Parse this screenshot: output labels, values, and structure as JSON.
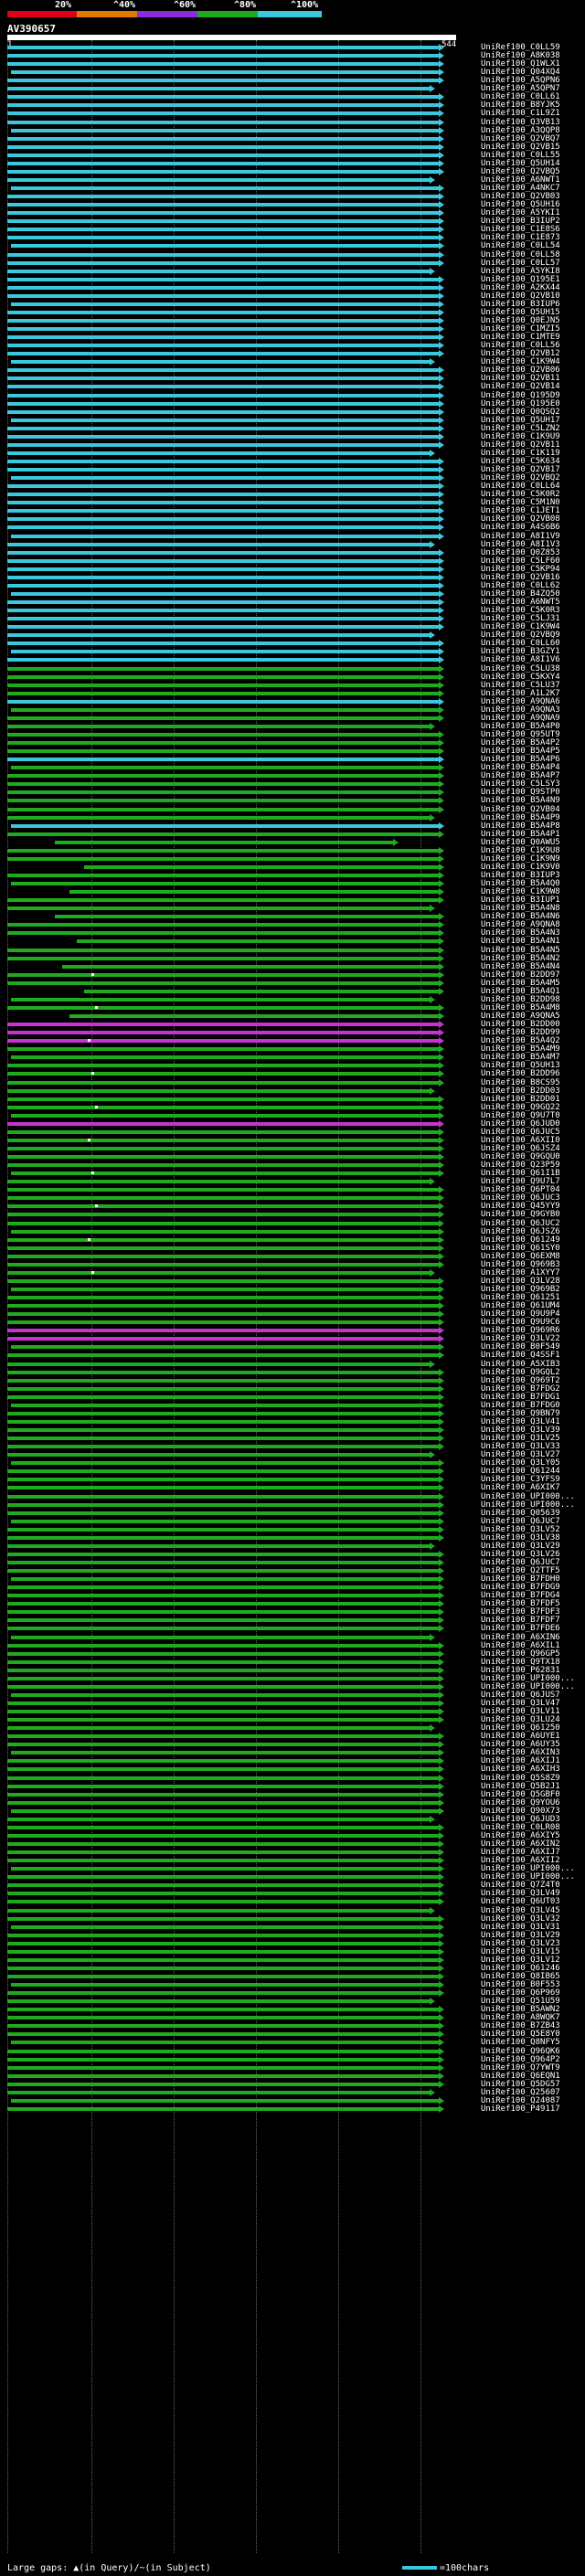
{
  "scale": {
    "labels": [
      "20%",
      "^40%",
      "^60%",
      "^80%",
      "^100%"
    ],
    "colors": [
      "#e0001a",
      "#e07a00",
      "#8a2be2",
      "#1faa1f",
      "#3cc8dc"
    ]
  },
  "query": {
    "name": "AV390657",
    "start": "1",
    "end": "544"
  },
  "legend": {
    "gaps_text": "Large gaps: ▲(in Query)/~(in Subject)",
    "scale_text": "=100chars"
  },
  "hit_colors": {
    "cyan": "#3cc8dc",
    "green": "#1faa1f",
    "magenta": "#c832d2"
  },
  "hits": [
    "UniRef100_C0LL59",
    "UniRef100_A8K038",
    "UniRef100_Q1WLX1",
    "UniRef100_Q04XQ4",
    "UniRef100_A5QPN6",
    "UniRef100_A5QPN7",
    "UniRef100_C0LL61",
    "UniRef100_B8YJK5",
    "UniRef100_C1L9Z1",
    "UniRef100_Q3VB13",
    "UniRef100_A3QQP8",
    "UniRef100_Q2VBQ7",
    "UniRef100_Q2VB15",
    "UniRef100_C0LL55",
    "UniRef100_Q5UH14",
    "UniRef100_Q2VBQ5",
    "UniRef100_A6NWT1",
    "UniRef100_A4NKC7",
    "UniRef100_Q2VB03",
    "UniRef100_Q5UH16",
    "UniRef100_A5YKI1",
    "UniRef100_B3IUP2",
    "UniRef100_C1E8S6",
    "UniRef100_C1E873",
    "UniRef100_C0LL54",
    "UniRef100_C0LL58",
    "UniRef100_C0LL57",
    "UniRef100_A5YKI8",
    "UniRef100_Q195E1",
    "UniRef100_A2KX44",
    "UniRef100_Q2VB10",
    "UniRef100_B3IUP6",
    "UniRef100_Q5UH15",
    "UniRef100_Q0EJN5",
    "UniRef100_C1MZI5",
    "UniRef100_C1MTE9",
    "UniRef100_C0LL56",
    "UniRef100_Q2VB12",
    "UniRef100_C1K9W4",
    "UniRef100_Q2VB06",
    "UniRef100_Q2VB11",
    "UniRef100_Q2VB14",
    "UniRef100_Q195D9",
    "UniRef100_Q195E0",
    "UniRef100_Q0QSQ2",
    "UniRef100_Q5UH17",
    "UniRef100_C5LZN2",
    "UniRef100_C1K9U9",
    "UniRef100_Q2VB11",
    "UniRef100_C1K119",
    "UniRef100_C5K634",
    "UniRef100_Q2VB17",
    "UniRef100_Q2VBQ2",
    "UniRef100_C0LL64",
    "UniRef100_C5K0R2",
    "UniRef100_C5M1N0",
    "UniRef100_C1JET1",
    "UniRef100_Q2VB08",
    "UniRef100_A4S6B6",
    "UniRef100_A8I1V9",
    "UniRef100_A8I1V3",
    "UniRef100_Q0Z853",
    "UniRef100_C5LF60",
    "UniRef100_C5KP94",
    "UniRef100_Q2VB16",
    "UniRef100_C0LL62",
    "UniRef100_B4ZQ50",
    "UniRef100_A6NWT5",
    "UniRef100_C5K0R3",
    "UniRef100_C5LJ31",
    "UniRef100_C1K9W4",
    "UniRef100_Q2VBQ9",
    "UniRef100_C0LL60",
    "UniRef100_B3GZY1",
    "UniRef100_A8I1V6",
    "UniRef100_C5LU38",
    "UniRef100_C5KXY4",
    "UniRef100_C5LU37",
    "UniRef100_A1L2K7",
    "UniRef100_A9QNA6",
    "UniRef100_A9QNA3",
    "UniRef100_A9QNA9",
    "UniRef100_B5A4P0",
    "UniRef100_Q95UT9",
    "UniRef100_B5A4P2",
    "UniRef100_B5A4P5",
    "UniRef100_B5A4P6",
    "UniRef100_B5A4P4",
    "UniRef100_B5A4P7",
    "UniRef100_C5LSY3",
    "UniRef100_Q9STP0",
    "UniRef100_B5A4N9",
    "UniRef100_Q2VB04",
    "UniRef100_B5A4P9",
    "UniRef100_B5A4P8",
    "UniRef100_B5A4P1",
    "UniRef100_Q0AWU5",
    "UniRef100_C1K9U8",
    "UniRef100_C1K9N9",
    "UniRef100_C1K9V0",
    "UniRef100_B3IUP3",
    "UniRef100_B5A4Q0",
    "UniRef100_C1K9W8",
    "UniRef100_B3IUP1",
    "UniRef100_B5A4N8",
    "UniRef100_B5A4N6",
    "UniRef100_A9QNA8",
    "UniRef100_B5A4N3",
    "UniRef100_B5A4N1",
    "UniRef100_B5A4N5",
    "UniRef100_B5A4N2",
    "UniRef100_B5A4N4",
    "UniRef100_B2DD97",
    "UniRef100_B5A4M5",
    "UniRef100_B5A4Q1",
    "UniRef100_B2DD98",
    "UniRef100_B5A4M8",
    "UniRef100_A9QNA5",
    "UniRef100_B2DD00",
    "UniRef100_B2DD99",
    "UniRef100_B5A4Q2",
    "UniRef100_B5A4M9",
    "UniRef100_B5A4M7",
    "UniRef100_Q5UH13",
    "UniRef100_B2DD96",
    "UniRef100_B8CS95",
    "UniRef100_B2DD03",
    "UniRef100_B2DD01",
    "UniRef100_Q9GQ22",
    "UniRef100_Q9U7T0",
    "UniRef100_Q6JUD0",
    "UniRef100_Q6JUC5",
    "UniRef100_A6XII0",
    "UniRef100_Q6JSZ4",
    "UniRef100_Q9GQU0",
    "UniRef100_Q23P59",
    "UniRef100_Q61I1B",
    "UniRef100_Q9U7L7",
    "UniRef100_Q6PT04",
    "UniRef100_Q6JUC3",
    "UniRef100_Q45YY9",
    "UniRef100_Q9GYB0",
    "UniRef100_Q6JUC2",
    "UniRef100_Q6JSZ6",
    "UniRef100_Q61249",
    "UniRef100_Q61SY0",
    "UniRef100_Q6EXM8",
    "UniRef100_Q969B3",
    "UniRef100_A1XYY7",
    "UniRef100_Q3LV28",
    "UniRef100_Q969B2",
    "UniRef100_Q61251",
    "UniRef100_Q61UM4",
    "UniRef100_Q9U9P4",
    "UniRef100_Q9U9C6",
    "UniRef100_Q969R6",
    "UniRef100_Q3LV22",
    "UniRef100_B0F549",
    "UniRef100_Q4SSF1",
    "UniRef100_A5XIB3",
    "UniRef100_Q9GQL2",
    "UniRef100_Q969T2",
    "UniRef100_B7FDG2",
    "UniRef100_B7FDG1",
    "UniRef100_B7FDG0",
    "UniRef100_Q9BN79",
    "UniRef100_Q3LV41",
    "UniRef100_Q3LV39",
    "UniRef100_Q3LV25",
    "UniRef100_Q3LV33",
    "UniRef100_Q3LV27",
    "UniRef100_Q3LY05",
    "UniRef100_Q61244",
    "UniRef100_C3YFS9",
    "UniRef100_A6XIK7",
    "UniRef100_UPI000...",
    "UniRef100_UPI000...",
    "UniRef100_Q05639",
    "UniRef100_Q6JUC7",
    "UniRef100_Q3LV52",
    "UniRef100_Q3LV38",
    "UniRef100_Q3LV29",
    "UniRef100_Q3LV26",
    "UniRef100_Q6JUC7",
    "UniRef100_Q2TTF5",
    "UniRef100_B7FDH0",
    "UniRef100_B7FDG9",
    "UniRef100_B7FDG4",
    "UniRef100_B7FDF5",
    "UniRef100_B7FDF3",
    "UniRef100_B7FDF7",
    "UniRef100_B7FDE6",
    "UniRef100_A6XIN6",
    "UniRef100_A6XIL1",
    "UniRef100_Q96GP5",
    "UniRef100_Q9TX18",
    "UniRef100_P62831",
    "UniRef100_UPI000...",
    "UniRef100_UPI000...",
    "UniRef100_Q6JUS7",
    "UniRef100_Q3LV47",
    "UniRef100_Q3LV11",
    "UniRef100_Q3LU24",
    "UniRef100_Q61250",
    "UniRef100_A6UYE1",
    "UniRef100_A6UY35",
    "UniRef100_A6XIN3",
    "UniRef100_A6XIJ1",
    "UniRef100_A6XIH3",
    "UniRef100_Q5S8Z9",
    "UniRef100_Q5B2J1",
    "UniRef100_Q5GBF0",
    "UniRef100_Q9YOU6",
    "UniRef100_Q90X73",
    "UniRef100_Q6JUD3",
    "UniRef100_C0LR08",
    "UniRef100_A6XIY5",
    "UniRef100_A6XIN2",
    "UniRef100_A6XIJ7",
    "UniRef100_A6XII2",
    "UniRef100_UPI000...",
    "UniRef100_UPI000...",
    "UniRef100_Q7Z4T0",
    "UniRef100_Q3LV49",
    "UniRef100_Q6UT03",
    "UniRef100_Q3LV45",
    "UniRef100_Q3LV32",
    "UniRef100_Q3LV31",
    "UniRef100_Q3LV29",
    "UniRef100_Q3LV23",
    "UniRef100_Q3LV15",
    "UniRef100_Q3LV12",
    "UniRef100_Q61246",
    "UniRef100_Q8IB65",
    "UniRef100_B0F553",
    "UniRef100_Q6P969",
    "UniRef100_Q51U59",
    "UniRef100_B5AWN2",
    "UniRef100_A8WQK7",
    "UniRef100_B7ZB43",
    "UniRef100_Q5E8Y0",
    "UniRef100_Q8NFY5",
    "UniRef100_Q96QK6",
    "UniRef100_Q964P2",
    "UniRef100_Q7YWT9",
    "UniRef100_Q6EQN1",
    "UniRef100_Q5DG57",
    "UniRef100_Q25607",
    "UniRef100_Q24087",
    "UniRef100_P49117"
  ]
}
